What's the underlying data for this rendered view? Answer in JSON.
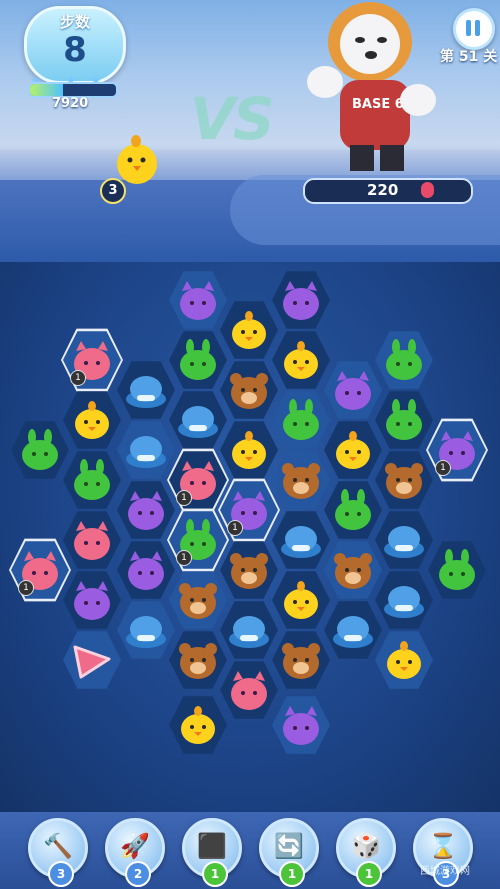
{
  "hud": {
    "moves_label": "步数",
    "moves_value": "8",
    "score_value": "7920",
    "score_progress": 0.38,
    "level_label": "第 51 关",
    "boss_hp_value": "220",
    "boss_hp_fraction": 0.27,
    "chick_counter": "3",
    "vs_text": "VS",
    "boss_shirt_text": "BASE 6"
  },
  "colors": {
    "purple": "#9a5ce0",
    "green": "#43c43f",
    "yellow": "#ffd21e",
    "brown": "#b46a2c",
    "blue": "#4fa0e6",
    "pink": "#f06a8a",
    "hp": "#e94a6a"
  },
  "board": {
    "pieces_note": "",
    "cells": [
      {
        "piece": "purple"
      },
      {
        "piece": "purple"
      },
      {
        "piece": "yellow"
      },
      {
        "piece": "pink-blocked",
        "counter": "1"
      },
      {
        "piece": "green"
      },
      {
        "piece": "yellow"
      },
      {
        "piece": "green"
      },
      {
        "piece": "blue"
      },
      {
        "piece": "brown"
      },
      {
        "piece": "purple"
      },
      {
        "piece": "yellow"
      },
      {
        "piece": "blue"
      },
      {
        "piece": "green"
      },
      {
        "piece": "green"
      },
      {
        "piece": "green"
      },
      {
        "piece": "blue"
      },
      {
        "piece": "yellow"
      },
      {
        "piece": "yellow"
      },
      {
        "piece": "purple-blocked",
        "counter": "1"
      },
      {
        "piece": "green"
      },
      {
        "piece": "pink-blocked",
        "counter": "1"
      },
      {
        "piece": "brown"
      },
      {
        "piece": "brown"
      },
      {
        "piece": "purple"
      },
      {
        "piece": "purple-blocked",
        "counter": "1"
      },
      {
        "piece": "green"
      },
      {
        "piece": "pink"
      },
      {
        "piece": "green-blocked",
        "counter": "1"
      },
      {
        "piece": "blue"
      },
      {
        "piece": "blue"
      },
      {
        "piece": "pink-blocked",
        "counter": "1"
      },
      {
        "piece": "purple"
      },
      {
        "piece": "brown"
      },
      {
        "piece": "brown"
      },
      {
        "piece": "green"
      },
      {
        "piece": "purple"
      },
      {
        "piece": "brown"
      },
      {
        "piece": "yellow"
      },
      {
        "piece": "blue"
      },
      {
        "piece": "blue"
      },
      {
        "piece": "blue"
      },
      {
        "piece": "blue"
      },
      {
        "piece": "triangle"
      },
      {
        "piece": "brown"
      },
      {
        "piece": "brown"
      },
      {
        "piece": "yellow"
      },
      {
        "piece": "pink"
      },
      {
        "piece": "yellow"
      },
      {
        "piece": "purple"
      }
    ]
  },
  "tools": [
    {
      "name": "hammer",
      "count": "3"
    },
    {
      "name": "rocket",
      "count": "2"
    },
    {
      "name": "cube-swap",
      "count": "1"
    },
    {
      "name": "shuffle",
      "count": "1"
    },
    {
      "name": "dice",
      "count": "1"
    },
    {
      "name": "hourglass",
      "count": "3"
    }
  ],
  "watermark": "西城游戏网"
}
